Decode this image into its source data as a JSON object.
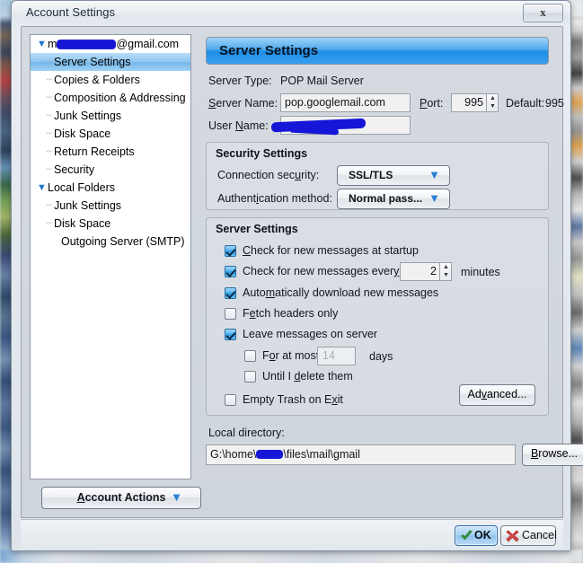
{
  "window": {
    "title": "Account Settings",
    "close_label": "x",
    "close_icon": "close-icon"
  },
  "sidebar": {
    "items": [
      {
        "label": "@gmail.com",
        "redacted_prefix": true,
        "level": 0,
        "twisty": "▼",
        "selected": false
      },
      {
        "label": "Server Settings",
        "level": 1,
        "selected": true
      },
      {
        "label": "Copies & Folders",
        "level": 1,
        "selected": false
      },
      {
        "label": "Composition & Addressing",
        "level": 1,
        "selected": false
      },
      {
        "label": "Junk Settings",
        "level": 1,
        "selected": false
      },
      {
        "label": "Disk Space",
        "level": 1,
        "selected": false
      },
      {
        "label": "Return Receipts",
        "level": 1,
        "selected": false
      },
      {
        "label": "Security",
        "level": 1,
        "selected": false
      },
      {
        "label": "Local Folders",
        "level": 0,
        "twisty": "▼",
        "selected": false
      },
      {
        "label": "Junk Settings",
        "level": 1,
        "selected": false
      },
      {
        "label": "Disk Space",
        "level": 1,
        "selected": false
      },
      {
        "label": "Outgoing Server (SMTP)",
        "level": 2,
        "selected": false
      }
    ],
    "account_actions": {
      "label": "Account Actions",
      "accesskey": "A",
      "arrow": "▼"
    }
  },
  "page": {
    "header": "Server Settings",
    "server_type_label": "Server Type:",
    "server_type_value": "POP Mail Server",
    "server_name_label": "Server Name:",
    "server_name_accesskey": "S",
    "server_name_value": "pop.googlemail.com",
    "port_label": "Port:",
    "port_accesskey": "P",
    "port_value": "995",
    "default_label": "Default:",
    "default_value": "995",
    "user_name_label": "User Name:",
    "user_name_accesskey": "N",
    "user_name_value": "",
    "user_name_redacted": true
  },
  "security_settings": {
    "title": "Security Settings",
    "connection_security_label": "Connection security:",
    "connection_security_accesskey": "u",
    "connection_security_value": "SSL/TLS",
    "auth_method_label": "Authentication method:",
    "auth_method_accesskey": "i",
    "auth_method_value": "Normal pass...",
    "arrow": "▼"
  },
  "server_settings": {
    "title": "Server Settings",
    "checks": [
      {
        "label": "Check for new messages at startup",
        "accesskey": "C",
        "checked": true
      },
      {
        "label": "Check for new messages every",
        "accesskey": "",
        "checked": true,
        "suffix": "minutes",
        "value": "2"
      },
      {
        "label": "Automatically download new messages",
        "accesskey": "m",
        "checked": true
      },
      {
        "label": "Fetch headers only",
        "accesskey": "e",
        "checked": false
      },
      {
        "label": "Leave messages on server",
        "accesskey": "g",
        "checked": true
      },
      {
        "label": "For at most",
        "accesskey": "o",
        "checked": false,
        "indent": true,
        "value": "14",
        "suffix": "days",
        "disabled": true
      },
      {
        "label": "Until I delete them",
        "accesskey": "d",
        "checked": false,
        "indent": true
      },
      {
        "label": "Empty Trash on Exit",
        "accesskey": "x",
        "checked": false
      }
    ],
    "advanced_button": "Advanced...",
    "advanced_accesskey": "v"
  },
  "local_directory": {
    "label": "Local directory:",
    "value_prefix": "G:\\home\\",
    "value_suffix": "\\files\\mail\\gmail",
    "redacted": true,
    "browse_button": "Browse...",
    "browse_accesskey": "B"
  },
  "footer": {
    "ok_label": "OK",
    "ok_icon": "checkmark-icon",
    "cancel_label": "Cancel",
    "cancel_icon": "x-mark-icon"
  },
  "colors": {
    "header_blue": "#1f8ce6",
    "selection_blue": "#8fc6ef",
    "redaction": "#1616d8",
    "ok_green": "#3aa23a",
    "cancel_red": "#cc3333"
  }
}
